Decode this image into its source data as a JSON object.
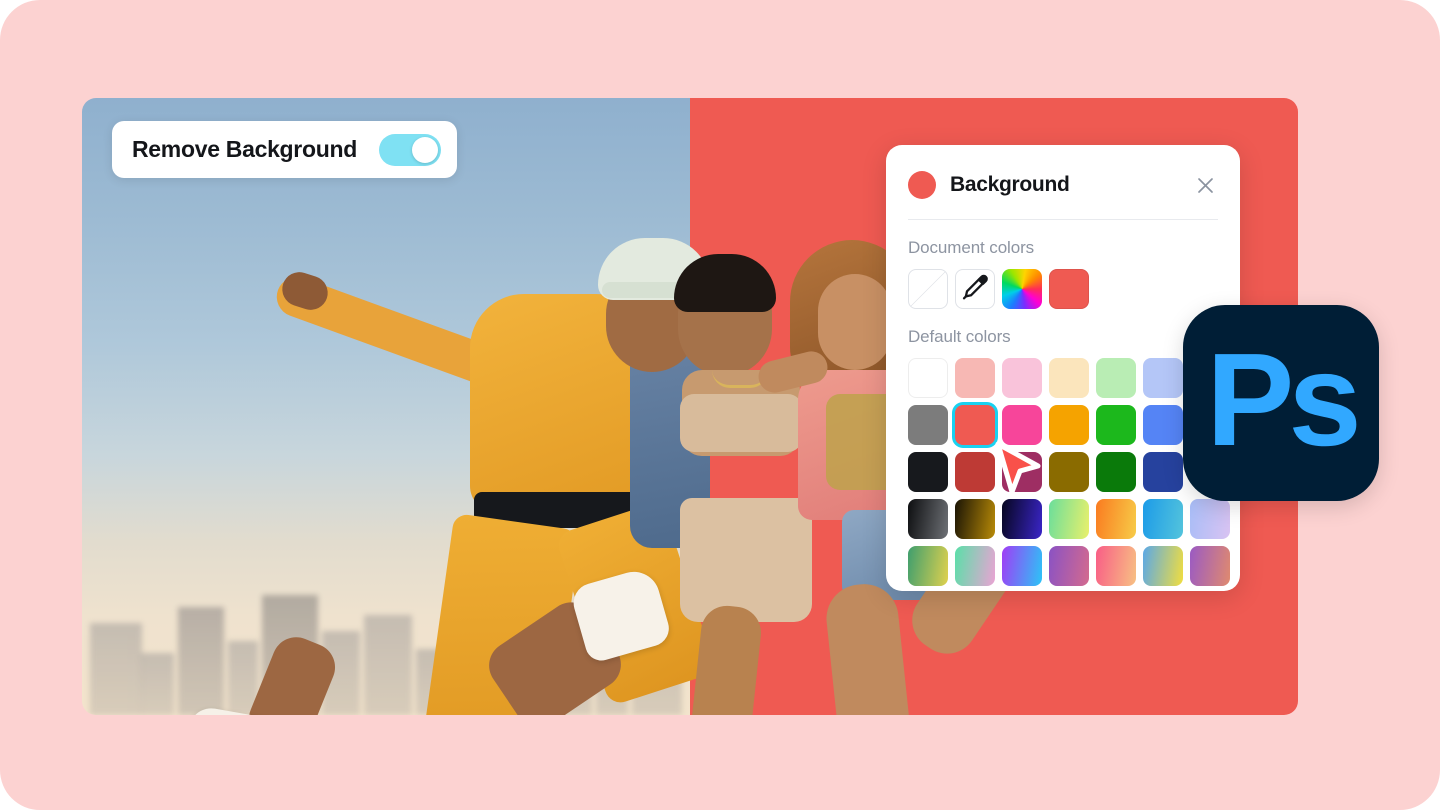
{
  "app": {
    "accent_red": "#EF5A52",
    "page_bg": "#FCD2D1",
    "toggle_on_color": "#7FE1F3",
    "selection_ring_color": "#19D2F0"
  },
  "remove_background": {
    "label": "Remove Background",
    "toggle_state": "on",
    "toggle_name": "remove-background-toggle"
  },
  "color_panel": {
    "title": "Background",
    "header_swatch_color": "#EF5A52",
    "close_icon": "close-icon",
    "document_colors": {
      "label": "Document colors",
      "swatches": [
        {
          "name": "no-color-swatch",
          "kind": "none",
          "color": "transparent"
        },
        {
          "name": "eyedropper-swatch",
          "kind": "eyedropper",
          "color": "#1A1C20"
        },
        {
          "name": "color-wheel-swatch",
          "kind": "rainbow",
          "color": "rainbow"
        },
        {
          "name": "document-color-red",
          "kind": "solid",
          "color": "#EF5A52"
        }
      ]
    },
    "default_colors": {
      "label": "Default colors",
      "selected_index": 8,
      "swatches": [
        {
          "name": "swatch-white",
          "color": "#FFFFFF",
          "type": "solid",
          "bordered": true
        },
        {
          "name": "swatch-light-salmon",
          "color": "#F7B8B4",
          "type": "solid"
        },
        {
          "name": "swatch-light-pink",
          "color": "#F9C3DA",
          "type": "solid"
        },
        {
          "name": "swatch-cream",
          "color": "#FBE5BC",
          "type": "solid"
        },
        {
          "name": "swatch-light-green",
          "color": "#B9EDB4",
          "type": "solid"
        },
        {
          "name": "swatch-periwinkle",
          "color": "#B4C6F7",
          "type": "solid"
        },
        {
          "name": "swatch-hidden-r1c7",
          "color": "#D9D9E3",
          "type": "solid"
        },
        {
          "name": "swatch-gray",
          "color": "#7C7C7C",
          "type": "solid"
        },
        {
          "name": "swatch-red",
          "color": "#EF5A52",
          "type": "solid",
          "selected": true
        },
        {
          "name": "swatch-hot-pink",
          "color": "#F7459A",
          "type": "solid"
        },
        {
          "name": "swatch-orange",
          "color": "#F5A300",
          "type": "solid"
        },
        {
          "name": "swatch-green",
          "color": "#1CB81C",
          "type": "solid"
        },
        {
          "name": "swatch-blue",
          "color": "#5584F5",
          "type": "solid"
        },
        {
          "name": "swatch-hidden-r2c7",
          "color": "#8EA5CF",
          "type": "solid"
        },
        {
          "name": "swatch-black",
          "color": "#17191D",
          "type": "solid"
        },
        {
          "name": "swatch-dark-red",
          "color": "#BE3A35",
          "type": "solid"
        },
        {
          "name": "swatch-dark-magenta",
          "color": "#9E2E63",
          "type": "solid"
        },
        {
          "name": "swatch-olive",
          "color": "#8A6B00",
          "type": "solid"
        },
        {
          "name": "swatch-dark-green",
          "color": "#0A7A0A",
          "type": "solid"
        },
        {
          "name": "swatch-navy",
          "color": "#26429E",
          "type": "solid"
        },
        {
          "name": "swatch-hidden-r3c7",
          "color": "#3D5A9E",
          "type": "solid"
        },
        {
          "name": "swatch-gradient-black-gray",
          "color": "linear-gradient(100deg,#0D0E10,#6E7176)",
          "type": "gradient"
        },
        {
          "name": "swatch-gradient-brown-gold",
          "color": "linear-gradient(100deg,#1A1405,#B98B07)",
          "type": "gradient"
        },
        {
          "name": "swatch-gradient-navy-indigo",
          "color": "linear-gradient(100deg,#06061E,#3A25C8)",
          "type": "gradient"
        },
        {
          "name": "swatch-gradient-green-yellow",
          "color": "linear-gradient(100deg,#6BDE9B,#EAF06B)",
          "type": "gradient"
        },
        {
          "name": "swatch-gradient-orange-yellow",
          "color": "linear-gradient(100deg,#FA7B20,#F7CC48)",
          "type": "gradient"
        },
        {
          "name": "swatch-gradient-blue-cyan",
          "color": "linear-gradient(100deg,#1C9BE8,#54C4DC)",
          "type": "gradient"
        },
        {
          "name": "swatch-gradient-periwinkle-lavender",
          "color": "linear-gradient(100deg,#A8BDF7,#D9C3F2)",
          "type": "gradient"
        },
        {
          "name": "swatch-gradient-green-gold",
          "color": "linear-gradient(100deg,#3E9E6E,#E0D14E)",
          "type": "gradient"
        },
        {
          "name": "swatch-gradient-teal-pink",
          "color": "linear-gradient(100deg,#5ADFA8,#EBA3D4)",
          "type": "gradient"
        },
        {
          "name": "swatch-gradient-purple-cyan",
          "color": "linear-gradient(100deg,#A13CF5,#2BC5F7)",
          "type": "gradient"
        },
        {
          "name": "swatch-gradient-purple-rose",
          "color": "linear-gradient(100deg,#8A52C4,#D46A8E)",
          "type": "gradient"
        },
        {
          "name": "swatch-gradient-pink-peach",
          "color": "linear-gradient(100deg,#F95D86,#F7C183)",
          "type": "gradient"
        },
        {
          "name": "swatch-gradient-blue-yellow",
          "color": "linear-gradient(100deg,#5AA8E8,#F2DE3E)",
          "type": "gradient"
        },
        {
          "name": "swatch-gradient-violet-salmon",
          "color": "linear-gradient(100deg,#9A5AC4,#E08A6E)",
          "type": "gradient"
        }
      ]
    }
  },
  "photoshop_logo": {
    "text": "Ps",
    "bg_color": "#001E36",
    "text_color": "#31A8FF"
  },
  "cursor": {
    "name": "arrow-cursor",
    "color": "#F9514A"
  }
}
